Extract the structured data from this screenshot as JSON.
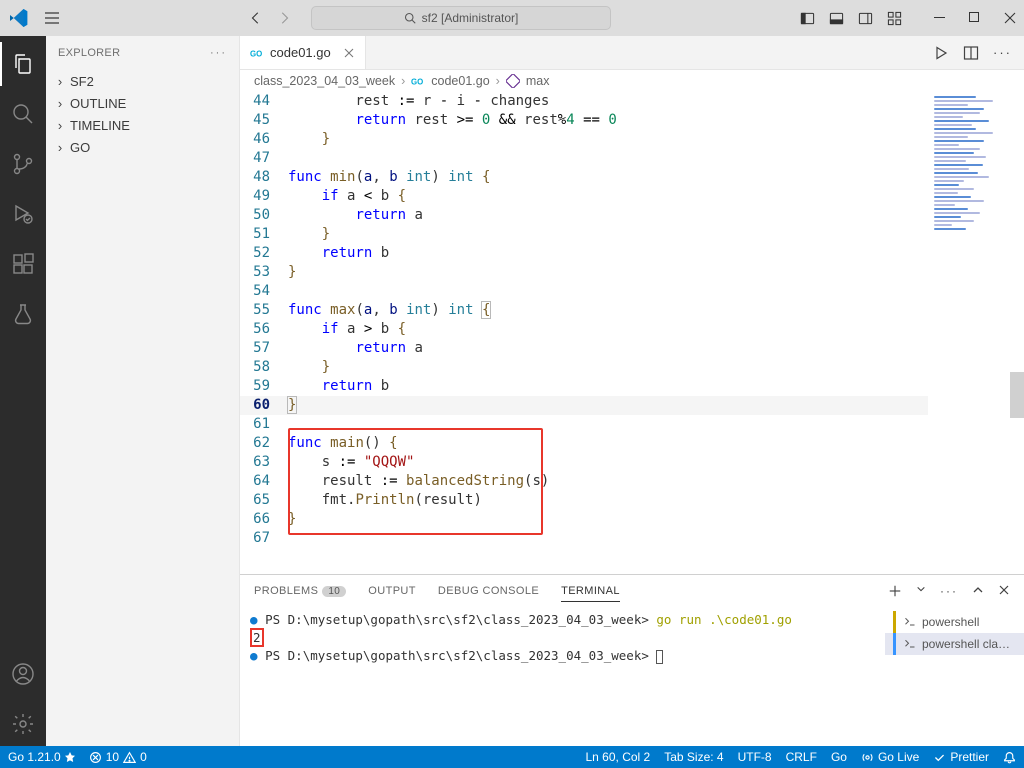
{
  "title": {
    "search": "sf2 [Administrator]"
  },
  "sidebar": {
    "header": "EXPLORER",
    "items": [
      "SF2",
      "OUTLINE",
      "TIMELINE",
      "GO"
    ]
  },
  "tab": {
    "name": "code01.go"
  },
  "breadcrumbs": {
    "a": "class_2023_04_03_week",
    "b": "code01.go",
    "c": "max"
  },
  "code": {
    "lines": [
      {
        "n": 44,
        "html": "        rest <span class='op'>:=</span> r <span class='op'>-</span> i <span class='op'>-</span> changes"
      },
      {
        "n": 45,
        "html": "        <span class='kw'>return</span> rest <span class='op'>&gt;=</span> <span class='nm'>0</span> <span class='op'>&amp;&amp;</span> rest<span class='op'>%</span><span class='nm'>4</span> <span class='op'>==</span> <span class='nm'>0</span>"
      },
      {
        "n": 46,
        "html": "    <span class='fn'>}</span>"
      },
      {
        "n": 47,
        "html": ""
      },
      {
        "n": 48,
        "html": "<span class='kw'>func</span> <span class='fn'>min</span>(<span class='id'>a</span>, <span class='id'>b</span> <span class='tp'>int</span>) <span class='tp'>int</span> <span class='fn'>{</span>"
      },
      {
        "n": 49,
        "html": "    <span class='kw'>if</span> a <span class='op'>&lt;</span> b <span class='fn'>{</span>"
      },
      {
        "n": 50,
        "html": "        <span class='kw'>return</span> a"
      },
      {
        "n": 51,
        "html": "    <span class='fn'>}</span>"
      },
      {
        "n": 52,
        "html": "    <span class='kw'>return</span> b"
      },
      {
        "n": 53,
        "html": "<span class='fn'>}</span>"
      },
      {
        "n": 54,
        "html": ""
      },
      {
        "n": 55,
        "html": "<span class='kw'>func</span> <span class='fn'>max</span>(<span class='id'>a</span>, <span class='id'>b</span> <span class='tp'>int</span>) <span class='tp'>int</span> <span class='cur-br fn'>{</span>"
      },
      {
        "n": 56,
        "html": "    <span class='kw'>if</span> a <span class='op'>&gt;</span> b <span class='fn'>{</span>"
      },
      {
        "n": 57,
        "html": "        <span class='kw'>return</span> a"
      },
      {
        "n": 58,
        "html": "    <span class='fn'>}</span>"
      },
      {
        "n": 59,
        "html": "    <span class='kw'>return</span> b"
      },
      {
        "n": 60,
        "cur": true,
        "html": "<span class='cur-br fn'>}</span>"
      },
      {
        "n": 61,
        "html": ""
      },
      {
        "n": 62,
        "html": "<span class='kw'>func</span> <span class='fn'>main</span>() <span class='fn'>{</span>"
      },
      {
        "n": 63,
        "html": "    s <span class='op'>:=</span> <span class='st'>\"QQQW\"</span>"
      },
      {
        "n": 64,
        "html": "    result <span class='op'>:=</span> <span class='fn'>balancedString</span>(s)"
      },
      {
        "n": 65,
        "html": "    fmt.<span class='fn'>Println</span>(result)"
      },
      {
        "n": 66,
        "html": "<span class='fn'>}</span>"
      },
      {
        "n": 67,
        "html": ""
      }
    ],
    "highlight": {
      "topLine": 62,
      "bottomLine": 66
    }
  },
  "panel": {
    "tabs": {
      "problems": "PROBLEMS",
      "problems_n": "10",
      "output": "OUTPUT",
      "debug": "DEBUG CONSOLE",
      "terminal": "TERMINAL"
    },
    "terminal": {
      "l1_prompt": "PS D:\\mysetup\\gopath\\src\\sf2\\class_2023_04_03_week>",
      "l1_cmd": "go run .\\code01.go",
      "l2": "2",
      "l3_prompt": "PS D:\\mysetup\\gopath\\src\\sf2\\class_2023_04_03_week>"
    },
    "tside": {
      "a": "powershell",
      "b": "powershell  cla…"
    }
  },
  "status": {
    "go": "Go 1.21.0",
    "err": "10",
    "warn": "0",
    "ln": "Ln 60, Col 2",
    "tab": "Tab Size: 4",
    "enc": "UTF-8",
    "eol": "CRLF",
    "lang": "Go",
    "live": "Go Live",
    "prettier": "Prettier"
  }
}
